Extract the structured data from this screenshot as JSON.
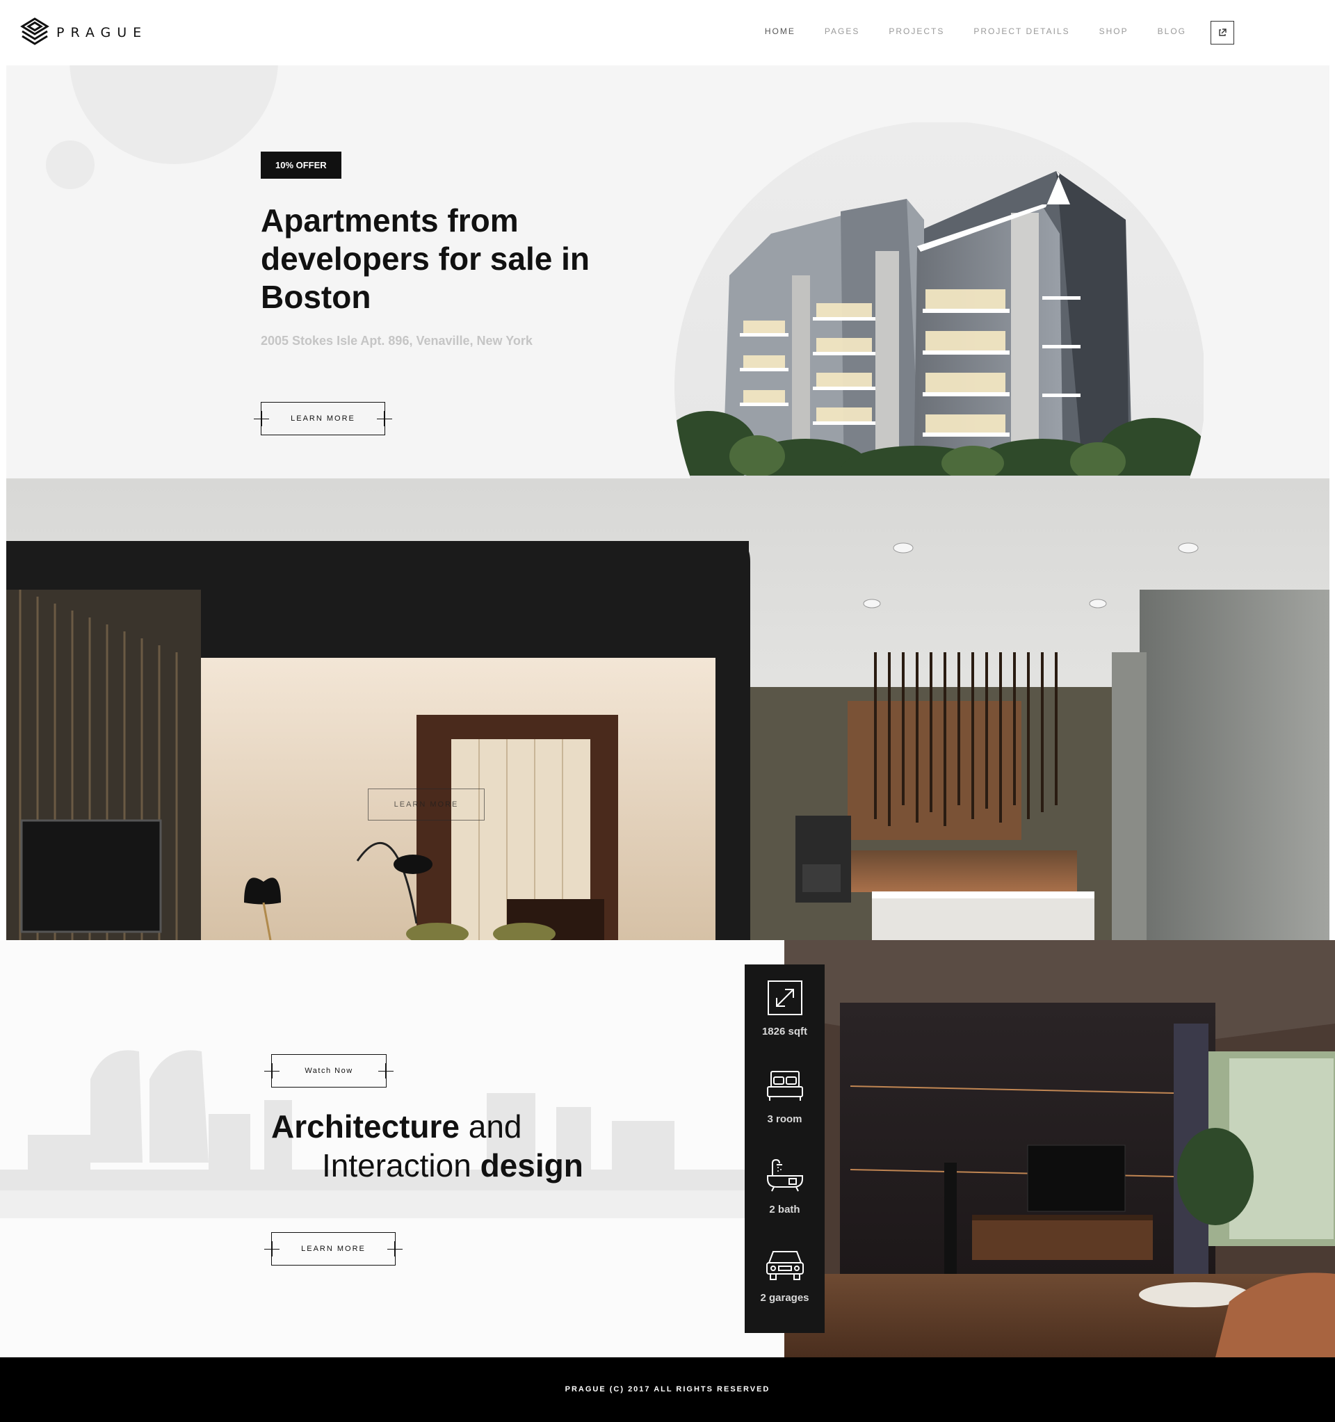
{
  "header": {
    "logo_text": "PRAGUE",
    "nav": [
      {
        "label": "HOME"
      },
      {
        "label": "PAGES"
      },
      {
        "label": "PROJECTS"
      },
      {
        "label": "PROJECT DETAILS"
      },
      {
        "label": "SHOP"
      },
      {
        "label": "BLOG"
      }
    ],
    "ext_icon": "external-link-icon"
  },
  "hero": {
    "badge": "10% OFFER",
    "title": "Apartments from developers for sale in Boston",
    "address": "2005 Stokes Isle Apt. 896, Venaville, New York",
    "button": "LEARN MORE"
  },
  "interior": {
    "ghost_button": "LEARN MORE"
  },
  "section": {
    "watch_button": "Watch Now",
    "title_bold_1": "Architecture",
    "title_light_1": " and",
    "title_light_2": "Interaction ",
    "title_bold_2": "design",
    "button": "LEARN MORE",
    "features": [
      {
        "icon": "expand-arrow-icon",
        "label": "1826 sqft"
      },
      {
        "icon": "bed-icon",
        "label": "3 room"
      },
      {
        "icon": "bathtub-icon",
        "label": "2 bath"
      },
      {
        "icon": "car-icon",
        "label": "2 garages"
      }
    ]
  },
  "footer": {
    "copyright": "PRAGUE (C) 2017 ALL RIGHTS RESERVED"
  },
  "colors": {
    "dark": "#111111",
    "hero_bg": "#f5f5f5",
    "muted_text": "#c5c5c5",
    "footer_bg": "#000000"
  }
}
